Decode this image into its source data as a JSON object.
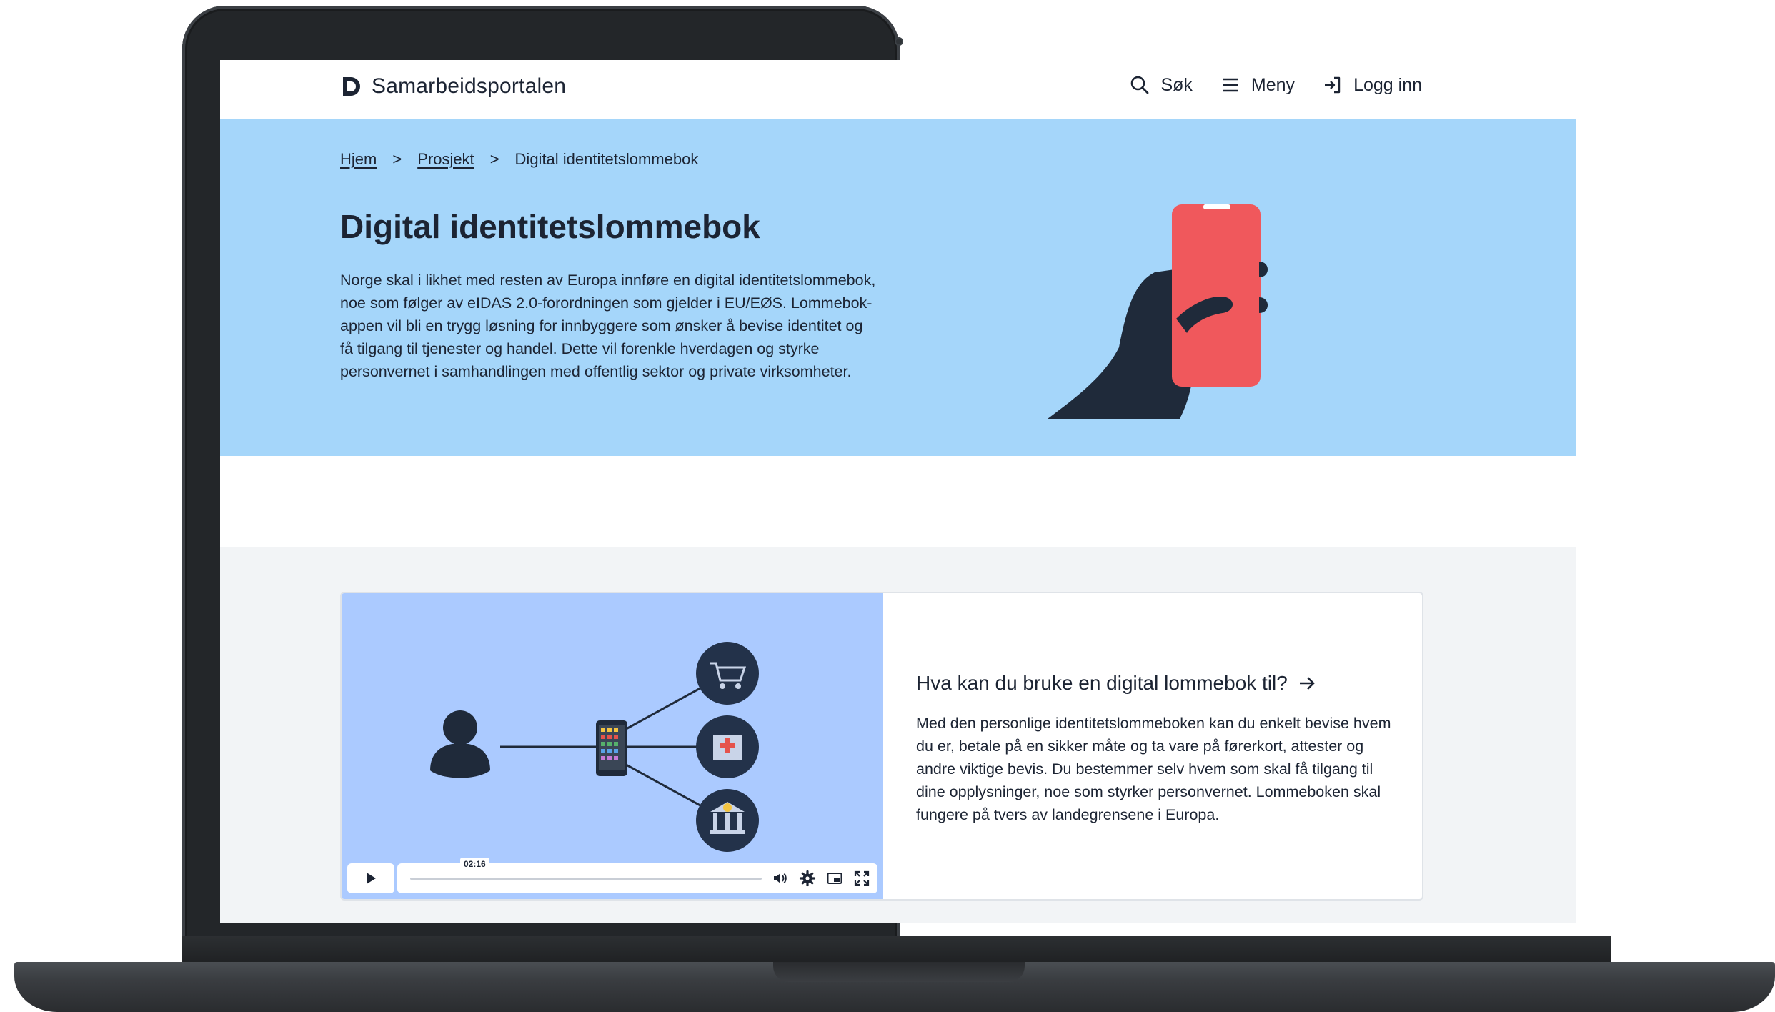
{
  "header": {
    "logo_text": "Samarbeidsportalen",
    "nav": [
      {
        "label": "Søk",
        "icon": "search-icon"
      },
      {
        "label": "Meny",
        "icon": "menu-icon"
      },
      {
        "label": "Logg inn",
        "icon": "login-icon"
      }
    ]
  },
  "breadcrumb": {
    "home": "Hjem",
    "project": "Prosjekt",
    "current": "Digital identitetslommebok",
    "separator": ">"
  },
  "hero": {
    "title": "Digital identitetslommebok",
    "text": "Norge skal i likhet med resten av Europa innføre en digital identitetslommebok, noe som følger av eIDAS 2.0-forordningen som gjelder i EU/EØS. Lommebok-appen vil bli en trygg løsning for innbyggere som ønsker å bevise identitet og få tilgang til tjenester og handel. Dette vil forenkle hverdagen og styrke personvernet i samhandlingen med offentlig sektor og private virksomheter."
  },
  "video": {
    "time": "02:16",
    "progress_fraction": 0.0
  },
  "card": {
    "title": "Hva kan du bruke en digital lommebok til?",
    "text": "Med den personlige identitetslommeboken kan du enkelt bevise hvem du er, betale på en sikker måte og ta vare på førerkort, attester og andre viktige bevis. Du bestemmer selv hvem som skal få tilgang til dine opplysninger, noe som styrker personvernet. Lommeboken skal fungere på tvers av landegrensene i Europa."
  },
  "colors": {
    "hero_bg": "#a5d6fa",
    "video_bg": "#abcaff",
    "text": "#1c2433",
    "phone": "#f0585c",
    "hand": "#1f2a3a",
    "lower_bg": "#f2f4f6"
  }
}
